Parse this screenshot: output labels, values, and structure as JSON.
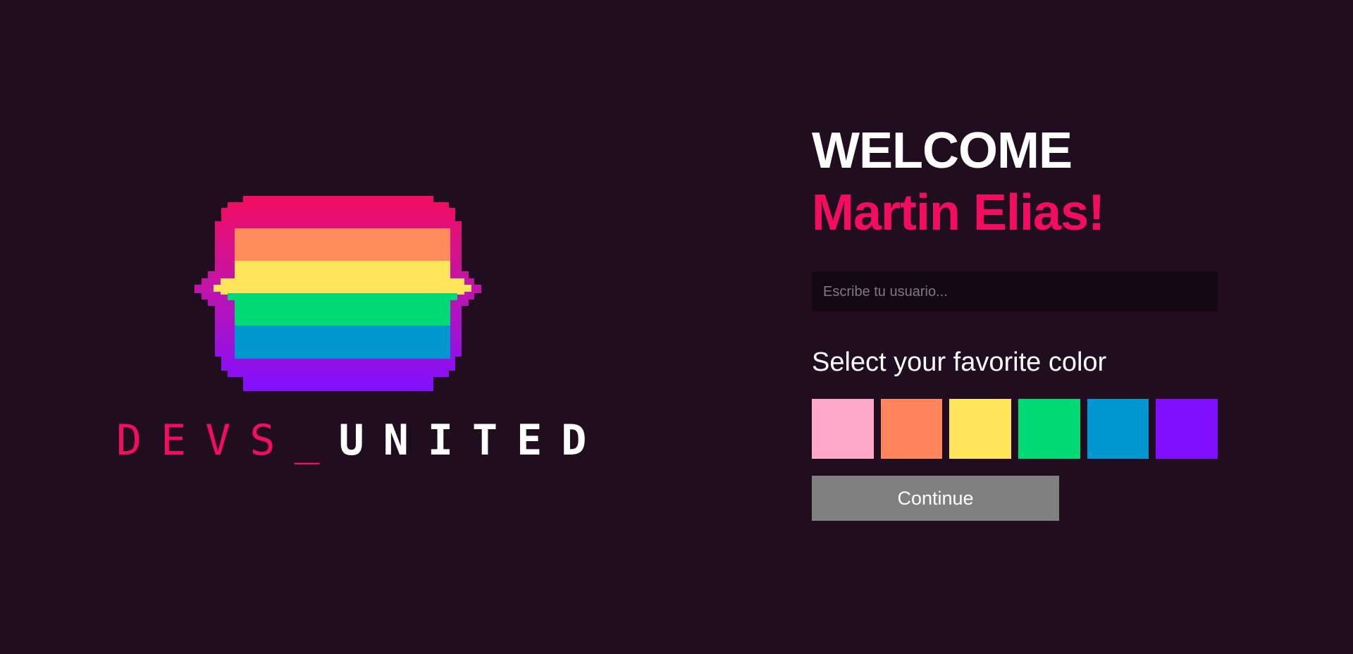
{
  "logo": {
    "icon_name": "rainbow-pixel-heart-logo",
    "wordmark_prefix": "DEVS_",
    "wordmark_suffix": "UNITED",
    "colors": {
      "pink": "#f20d5e",
      "orange": "#ff8a5c",
      "yellow": "#ffe55c",
      "green": "#00d974",
      "blue": "#0096ce",
      "purple": "#800fff",
      "border_magenta": "#c414a8"
    }
  },
  "welcome": {
    "greeting": "WELCOME",
    "name": "Martin Elias!"
  },
  "username_input": {
    "value": "",
    "placeholder": "Escribe tu usuario..."
  },
  "color_picker": {
    "heading": "Select your favorite color",
    "options": [
      {
        "name": "pink",
        "color": "#ffa8c8"
      },
      {
        "name": "orange",
        "color": "#ff865c"
      },
      {
        "name": "yellow",
        "color": "#ffe55c"
      },
      {
        "name": "green",
        "color": "#00d974"
      },
      {
        "name": "blue",
        "color": "#0096cf"
      },
      {
        "name": "purple",
        "color": "#800fff"
      }
    ]
  },
  "continue_button": {
    "label": "Continue"
  },
  "theme": {
    "background": "#200e20",
    "accent": "#f20d5e",
    "button_disabled": "#808080"
  }
}
